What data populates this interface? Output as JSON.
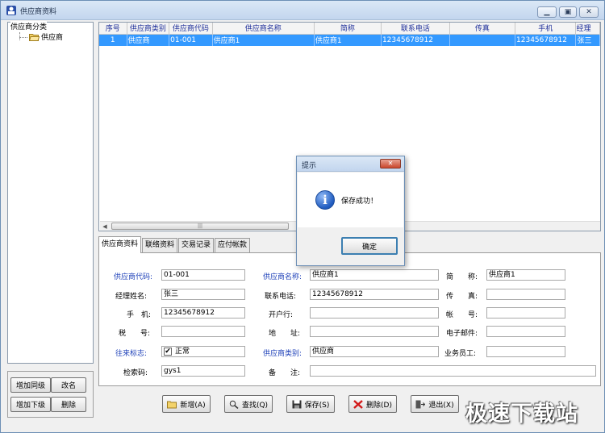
{
  "window": {
    "title": "供应商资料"
  },
  "tree": {
    "header": "供应商分类",
    "nodes": [
      "供应商"
    ]
  },
  "left_buttons": {
    "add_sibling": "增加同级",
    "rename": "改名",
    "add_child": "增加下级",
    "delete": "删除"
  },
  "grid": {
    "columns": [
      "序号",
      "供应商类别",
      "供应商代码",
      "供应商名称",
      "简称",
      "联系电话",
      "传真",
      "手机",
      "经理"
    ],
    "rows": [
      [
        "1",
        "供应商",
        "01-001",
        "供应商1",
        "供应商1",
        "12345678912",
        "",
        "12345678912",
        "张三"
      ]
    ]
  },
  "tabs": [
    "供应商资料",
    "联络资料",
    "交易记录",
    "应付帐款"
  ],
  "form": {
    "supplier_code": {
      "label": "供应商代码:",
      "value": "01-001"
    },
    "manager_name": {
      "label": "经理姓名:",
      "value": "张三"
    },
    "mobile": {
      "label": "手　机:",
      "value": "12345678912"
    },
    "tax_id": {
      "label": "税　　号:",
      "value": ""
    },
    "status": {
      "label": "往来标志:",
      "value": "正常",
      "checked": true
    },
    "search_code": {
      "label": "检索码:",
      "value": "gys1"
    },
    "supplier_name": {
      "label": "供应商名称:",
      "value": "供应商1"
    },
    "phone": {
      "label": "联系电话:",
      "value": "12345678912"
    },
    "bank": {
      "label": "开户行:",
      "value": ""
    },
    "address": {
      "label": "地　　址:",
      "value": ""
    },
    "category": {
      "label": "供应商类别:",
      "value": "供应商"
    },
    "remark": {
      "label": "备　　注:",
      "value": ""
    },
    "short_name": {
      "label": "简　　称:",
      "value": "供应商1"
    },
    "fax": {
      "label": "传　　真:",
      "value": ""
    },
    "account": {
      "label": "帐　　号:",
      "value": ""
    },
    "email": {
      "label": "电子邮件:",
      "value": ""
    },
    "salesperson": {
      "label": "业务员工:",
      "value": ""
    }
  },
  "bottom_buttons": {
    "new": "新增(A)",
    "find": "查找(Q)",
    "save": "保存(S)",
    "delete": "删除(D)",
    "exit": "退出(X)"
  },
  "dialog": {
    "title": "提示",
    "message": "保存成功！",
    "ok": "确定"
  },
  "watermark": "极速下载站",
  "colors": {
    "selection": "#3399ff",
    "header_text": "#1e2f9a",
    "label_blue": "#1c3fb8"
  }
}
